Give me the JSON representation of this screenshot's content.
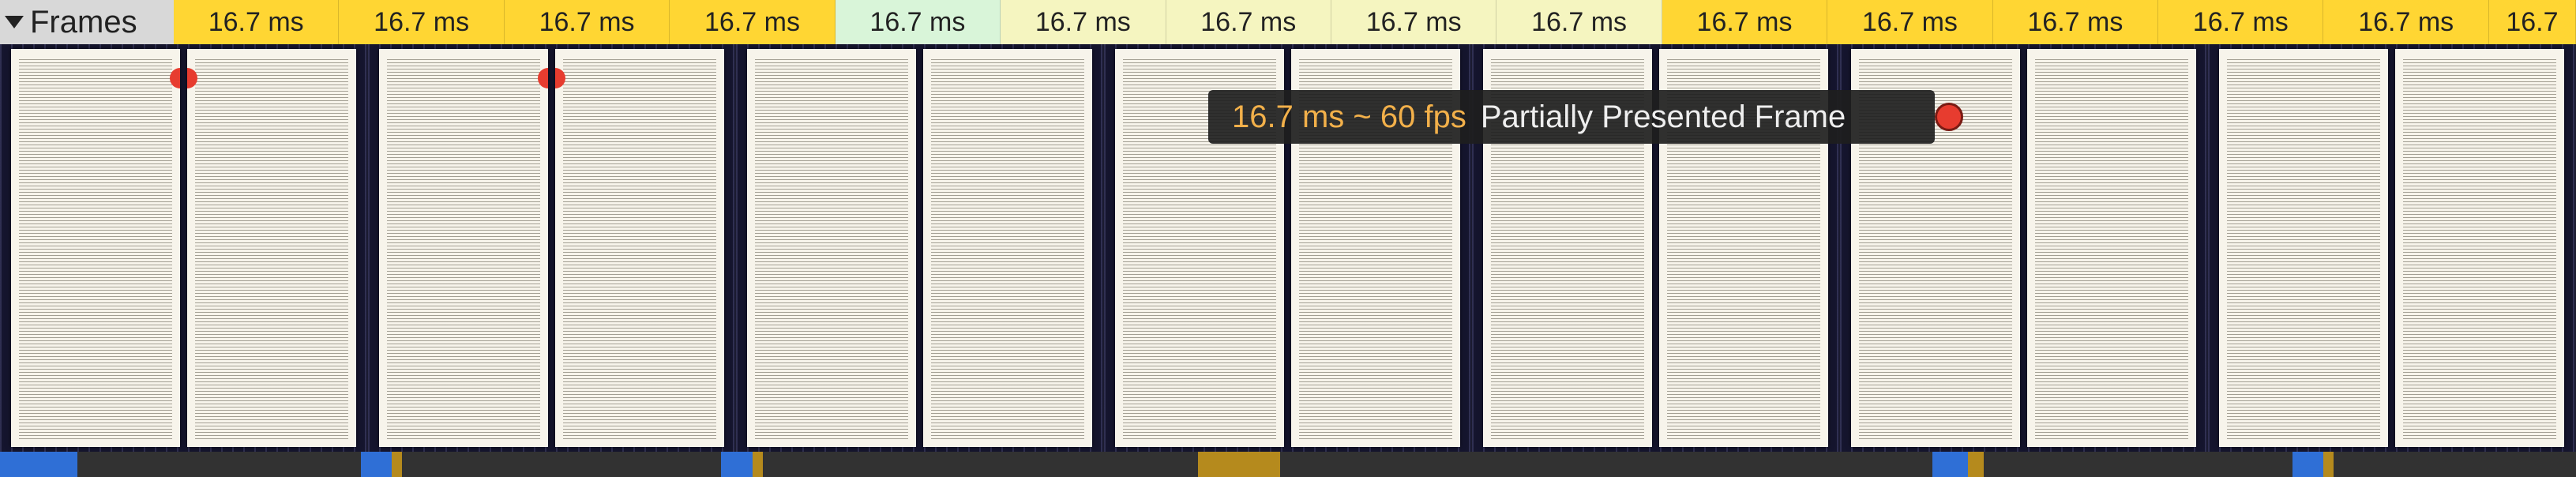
{
  "header": {
    "label": "Frames"
  },
  "frames": [
    {
      "label": "16.7 ms",
      "color": "yellow"
    },
    {
      "label": "16.7 ms",
      "color": "yellow"
    },
    {
      "label": "16.7 ms",
      "color": "yellow"
    },
    {
      "label": "16.7 ms",
      "color": "yellow"
    },
    {
      "label": "16.7 ms",
      "color": "green"
    },
    {
      "label": "16.7 ms",
      "color": "lemon"
    },
    {
      "label": "16.7 ms",
      "color": "lemon"
    },
    {
      "label": "16.7 ms",
      "color": "lemon"
    },
    {
      "label": "16.7 ms",
      "color": "lemon"
    },
    {
      "label": "16.7 ms",
      "color": "yellow"
    },
    {
      "label": "16.7 ms",
      "color": "yellow"
    },
    {
      "label": "16.7 ms",
      "color": "yellow"
    },
    {
      "label": "16.7 ms",
      "color": "yellow"
    },
    {
      "label": "16.7 ms",
      "color": "yellow"
    },
    {
      "label": "16.7",
      "color": "yellow",
      "last": true
    }
  ],
  "filmstrip": {
    "cell_count": 7,
    "pages_with_red_dot": [
      0,
      1
    ]
  },
  "tooltip": {
    "duration": "16.7 ms ~ 60 fps",
    "event": "Partially Presented Frame"
  },
  "activity": [
    {
      "start_pct": 0.0,
      "width_pct": 3.0,
      "color": "blue"
    },
    {
      "start_pct": 14.0,
      "width_pct": 1.2,
      "color": "blue"
    },
    {
      "start_pct": 15.2,
      "width_pct": 0.4,
      "color": "gold"
    },
    {
      "start_pct": 28.0,
      "width_pct": 1.2,
      "color": "blue"
    },
    {
      "start_pct": 29.2,
      "width_pct": 0.4,
      "color": "gold"
    },
    {
      "start_pct": 46.5,
      "width_pct": 3.2,
      "color": "gold"
    },
    {
      "start_pct": 75.0,
      "width_pct": 1.4,
      "color": "blue"
    },
    {
      "start_pct": 76.4,
      "width_pct": 0.6,
      "color": "gold"
    },
    {
      "start_pct": 89.0,
      "width_pct": 1.2,
      "color": "blue"
    },
    {
      "start_pct": 90.2,
      "width_pct": 0.4,
      "color": "gold"
    }
  ]
}
